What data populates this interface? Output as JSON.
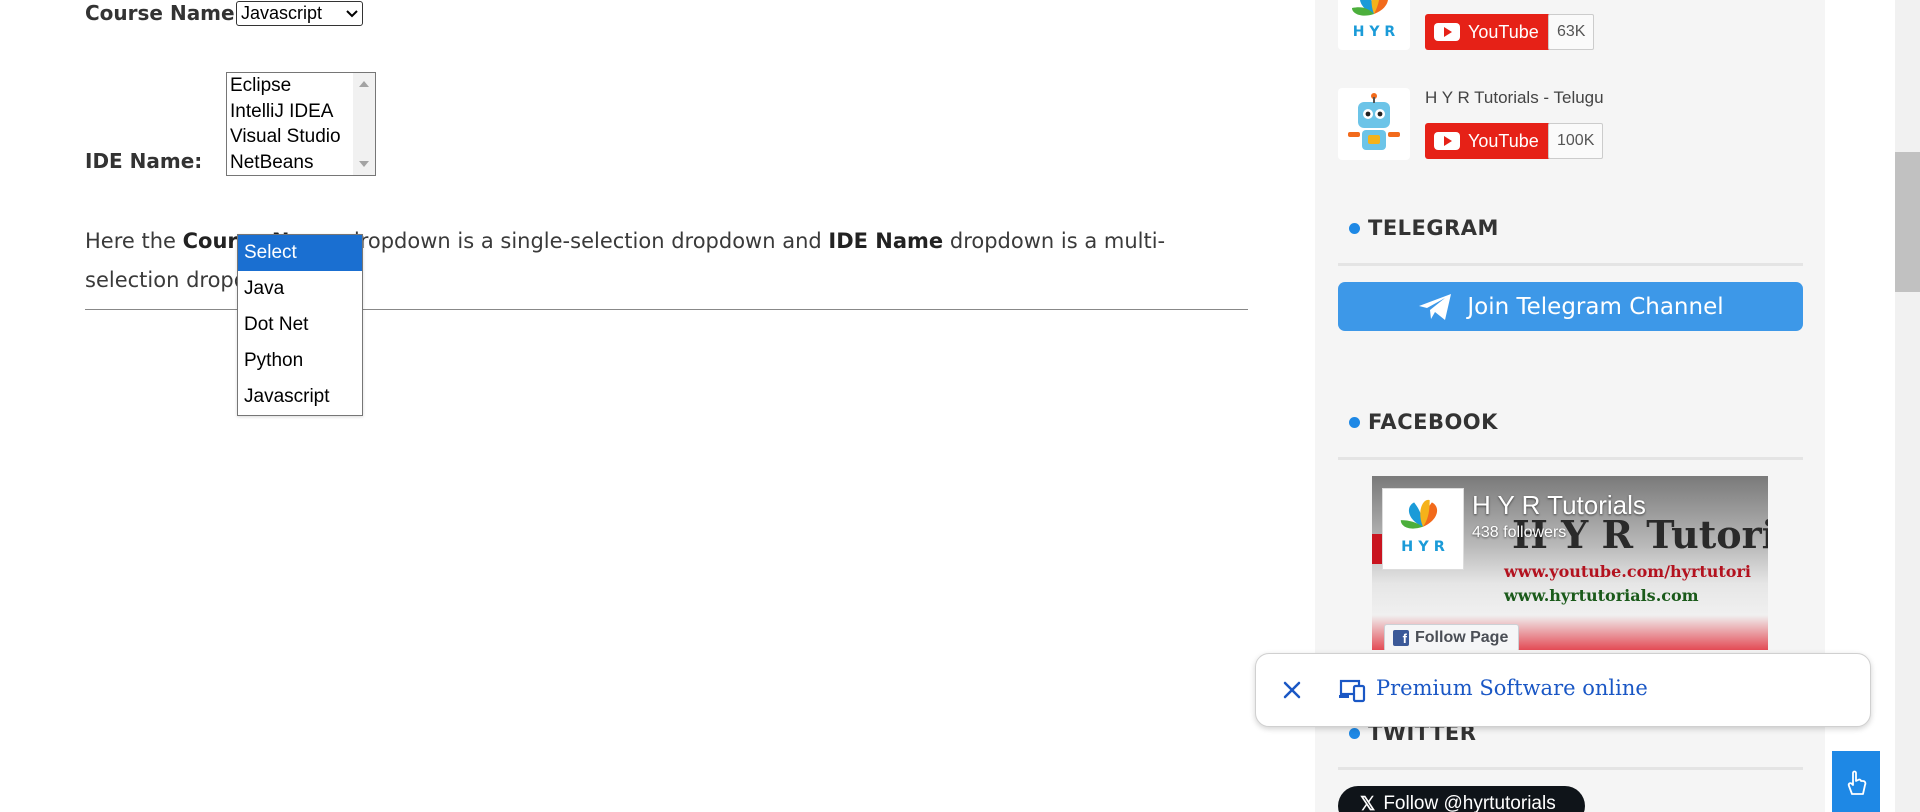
{
  "form": {
    "course_label": "Course Name:",
    "course_value": "Javascript",
    "ide_label": "IDE Name:",
    "ide_options": [
      "Eclipse",
      "IntelliJ IDEA",
      "Visual Studio",
      "NetBeans"
    ]
  },
  "paragraph": {
    "p1": "Here the ",
    "b1": "Course Name",
    "p2": " dropdown is a single-selection dropdown and ",
    "b2": "IDE Name",
    "p3": " dropdown is a multi-selection dropdown."
  },
  "dropdown_popup": {
    "options": [
      "Select",
      "Java",
      "Dot Net",
      "Python",
      "Javascript"
    ],
    "highlighted": "Select"
  },
  "sidebar": {
    "youtube_channels": [
      {
        "name": "",
        "button_label": "YouTube",
        "count": "63K"
      },
      {
        "name": "H Y R Tutorials - Telugu",
        "button_label": "YouTube",
        "count": "100K"
      }
    ],
    "telegram": {
      "title": "TELEGRAM",
      "button_label": "Join Telegram Channel"
    },
    "facebook": {
      "title": "FACEBOOK",
      "page_name": "H Y R Tutorials",
      "followers": "438 followers",
      "follow_label": "Follow Page",
      "banner_text": "H Y R Tutoria",
      "banner_url1": "www.youtube.com/hyrtutori",
      "banner_url2": "www.hyrtutorials.com"
    },
    "twitter": {
      "title": "TWITTER",
      "button_label": "Follow @hyrtutorials"
    }
  },
  "ad": {
    "text": "Premium Software online"
  },
  "colors": {
    "accent_blue": "#1e88e5",
    "youtube_red": "#e62117",
    "telegram_blue": "#3d98e8",
    "selection_blue": "#1a6fd1",
    "ad_link": "#1a57c5"
  },
  "icons": {
    "close": "close-icon",
    "devices": "devices-icon",
    "telegram": "telegram-icon",
    "touch": "touch-icon",
    "youtube": "youtube-play-icon"
  }
}
